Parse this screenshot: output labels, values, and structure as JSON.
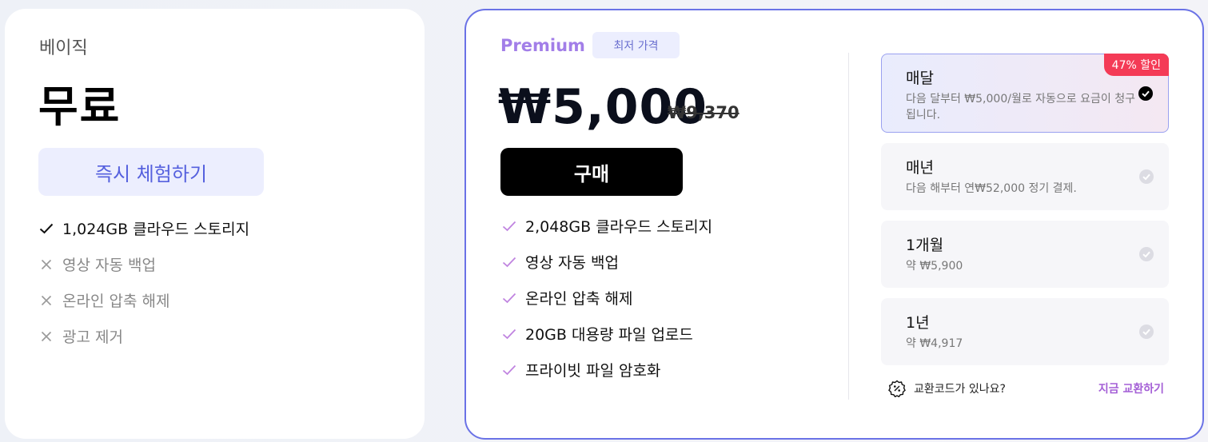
{
  "basic": {
    "name": "베이직",
    "price": "무료",
    "trial_label": "즉시 체험하기",
    "features": [
      {
        "label": "1,024GB 클라우드 스토리지",
        "included": true
      },
      {
        "label": "영상 자동 백업",
        "included": false
      },
      {
        "label": "온라인 압축 해제",
        "included": false
      },
      {
        "label": "광고 제거",
        "included": false
      }
    ]
  },
  "premium": {
    "name": "Premium",
    "badge": "최저 가격",
    "price": "₩5,000",
    "original_price": "₩9,370",
    "buy_label": "구매",
    "features": [
      {
        "label": "2,048GB 클라우드 스토리지"
      },
      {
        "label": "영상 자동 백업"
      },
      {
        "label": "온라인 압축 해제"
      },
      {
        "label": "20GB 대용량 파일 업로드"
      },
      {
        "label": "프라이빗 파일 암호화"
      }
    ],
    "plans": [
      {
        "title": "매달",
        "desc": "다음 달부터 ₩5,000/월로 자동으로 요금이 청구됩니다.",
        "selected": true,
        "discount": "47% 할인"
      },
      {
        "title": "매년",
        "desc": "다음 해부터 연₩52,000 정기 결제.",
        "selected": false
      },
      {
        "title": "1개월",
        "desc": "약 ₩5,900",
        "selected": false
      },
      {
        "title": "1년",
        "desc": "약 ₩4,917",
        "selected": false
      }
    ],
    "redeem": {
      "question": "교환코드가 있나요?",
      "link": "지금 교환하기"
    }
  },
  "colors": {
    "accent": "#6a72e6",
    "premium_label": "#a27ee8",
    "check_purple": "#c084e0",
    "discount_red": "#f43b56",
    "link_purple": "#a45fd6"
  }
}
